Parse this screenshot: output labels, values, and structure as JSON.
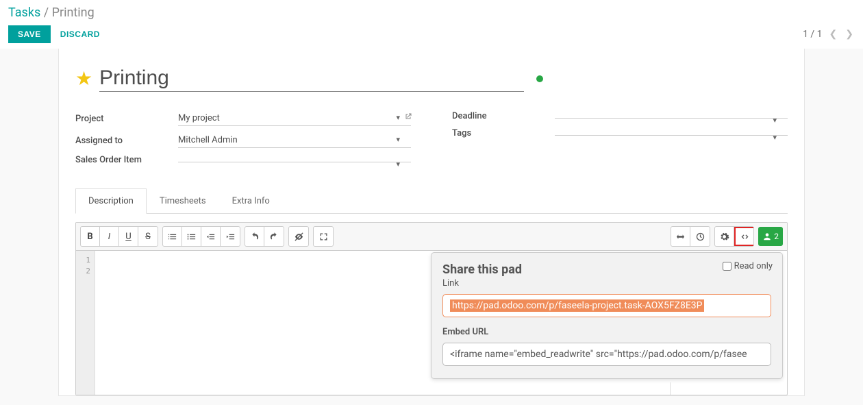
{
  "breadcrumb": {
    "root": "Tasks",
    "sep": "/",
    "current": "Printing"
  },
  "actions": {
    "save": "SAVE",
    "discard": "DISCARD"
  },
  "pager": {
    "text": "1 / 1"
  },
  "title": "Printing",
  "fields": {
    "project": {
      "label": "Project",
      "value": "My project"
    },
    "assigned": {
      "label": "Assigned to",
      "value": "Mitchell Admin"
    },
    "soi": {
      "label": "Sales Order Item",
      "value": ""
    },
    "deadline": {
      "label": "Deadline",
      "value": ""
    },
    "tags": {
      "label": "Tags",
      "value": ""
    }
  },
  "tabs": {
    "t0": "Description",
    "t1": "Timesheets",
    "t2": "Extra Info"
  },
  "gutter": {
    "l1": "1",
    "l2": "2"
  },
  "users_count": "2",
  "share": {
    "title": "Share this pad",
    "readonly_label": "Read only",
    "link_label": "Link",
    "link_value": "https://pad.odoo.com/p/faseela-project.task-AOX5FZ8E3P",
    "embed_label": "Embed URL",
    "embed_value": "<iframe name=\"embed_readwrite\" src=\"https://pad.odoo.com/p/fasee"
  }
}
